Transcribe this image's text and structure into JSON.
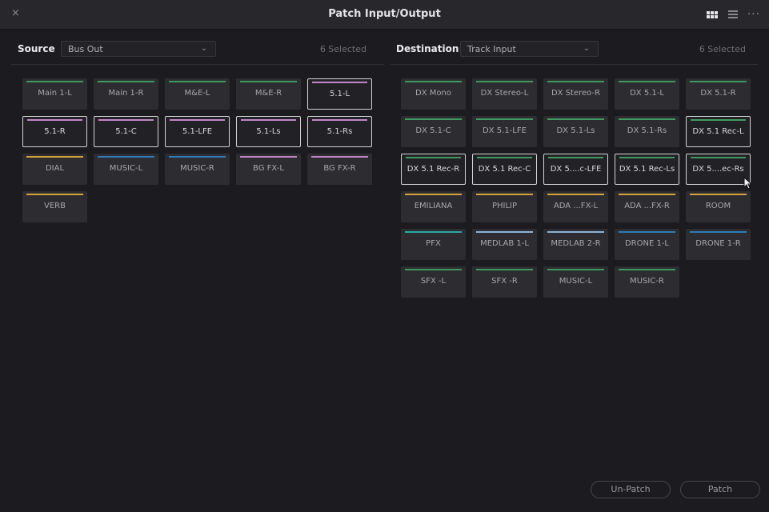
{
  "window": {
    "title": "Patch Input/Output",
    "close_glyph": "×",
    "more_glyph": "···"
  },
  "colors": {
    "green": "#3e9a61",
    "pink": "#c286c9",
    "yellow": "#d6a33b",
    "blue": "#2f7cb8",
    "teal": "#2aa7a3",
    "lightblue": "#8bb3d8",
    "white": "#d8d8da"
  },
  "source": {
    "label": "Source",
    "dropdown_value": "Bus Out",
    "selected_count": "6 Selected",
    "tiles": [
      {
        "label": "Main 1-L",
        "color": "#3e9a61",
        "selected": false
      },
      {
        "label": "Main 1-R",
        "color": "#3e9a61",
        "selected": false
      },
      {
        "label": "M&E-L",
        "color": "#3e9a61",
        "selected": false
      },
      {
        "label": "M&E-R",
        "color": "#3e9a61",
        "selected": false
      },
      {
        "label": "5.1-L",
        "color": "#c286c9",
        "selected": true
      },
      {
        "label": "5.1-R",
        "color": "#c286c9",
        "selected": true
      },
      {
        "label": "5.1-C",
        "color": "#c286c9",
        "selected": true
      },
      {
        "label": "5.1-LFE",
        "color": "#c286c9",
        "selected": true
      },
      {
        "label": "5.1-Ls",
        "color": "#c286c9",
        "selected": true
      },
      {
        "label": "5.1-Rs",
        "color": "#c286c9",
        "selected": true
      },
      {
        "label": "DIAL",
        "color": "#d6a33b",
        "selected": false
      },
      {
        "label": "MUSIC-L",
        "color": "#2f7cb8",
        "selected": false
      },
      {
        "label": "MUSIC-R",
        "color": "#2f7cb8",
        "selected": false
      },
      {
        "label": "BG FX-L",
        "color": "#c286c9",
        "selected": false
      },
      {
        "label": "BG FX-R",
        "color": "#c286c9",
        "selected": false
      },
      {
        "label": "VERB",
        "color": "#d6a33b",
        "selected": false
      }
    ]
  },
  "destination": {
    "label": "Destination",
    "dropdown_value": "Track Input",
    "selected_count": "6 Selected",
    "tiles": [
      {
        "label": "DX Mono",
        "color": "#3e9a61",
        "selected": false
      },
      {
        "label": "DX Stereo-L",
        "color": "#3e9a61",
        "selected": false
      },
      {
        "label": "DX Stereo-R",
        "color": "#3e9a61",
        "selected": false
      },
      {
        "label": "DX 5.1-L",
        "color": "#3e9a61",
        "selected": false
      },
      {
        "label": "DX 5.1-R",
        "color": "#3e9a61",
        "selected": false
      },
      {
        "label": "DX 5.1-C",
        "color": "#3e9a61",
        "selected": false
      },
      {
        "label": "DX 5.1-LFE",
        "color": "#3e9a61",
        "selected": false
      },
      {
        "label": "DX 5.1-Ls",
        "color": "#3e9a61",
        "selected": false
      },
      {
        "label": "DX 5.1-Rs",
        "color": "#3e9a61",
        "selected": false
      },
      {
        "label": "DX 5.1 Rec-L",
        "color": "#3e9a61",
        "selected": true
      },
      {
        "label": "DX 5.1 Rec-R",
        "color": "#3e9a61",
        "selected": true
      },
      {
        "label": "DX 5.1 Rec-C",
        "color": "#3e9a61",
        "selected": true
      },
      {
        "label": "DX 5....c-LFE",
        "color": "#3e9a61",
        "selected": true
      },
      {
        "label": "DX 5.1 Rec-Ls",
        "color": "#3e9a61",
        "selected": true
      },
      {
        "label": "DX 5....ec-Rs",
        "color": "#3e9a61",
        "selected": true
      },
      {
        "label": "EMILIANA",
        "color": "#d6a33b",
        "selected": false
      },
      {
        "label": "PHILIP",
        "color": "#d6a33b",
        "selected": false
      },
      {
        "label": "ADA ...FX-L",
        "color": "#d6a33b",
        "selected": false
      },
      {
        "label": "ADA ...FX-R",
        "color": "#d6a33b",
        "selected": false
      },
      {
        "label": "ROOM",
        "color": "#d6a33b",
        "selected": false
      },
      {
        "label": "PFX",
        "color": "#2aa7a3",
        "selected": false
      },
      {
        "label": "MEDLAB 1-L",
        "color": "#8bb3d8",
        "selected": false
      },
      {
        "label": "MEDLAB 2-R",
        "color": "#8bb3d8",
        "selected": false
      },
      {
        "label": "DRONE 1-L",
        "color": "#2f7cb8",
        "selected": false
      },
      {
        "label": "DRONE 1-R",
        "color": "#2f7cb8",
        "selected": false
      },
      {
        "label": "SFX -L",
        "color": "#3e9a61",
        "selected": false
      },
      {
        "label": "SFX -R",
        "color": "#3e9a61",
        "selected": false
      },
      {
        "label": "MUSIC-L",
        "color": "#3e9a61",
        "selected": false
      },
      {
        "label": "MUSIC-R",
        "color": "#3e9a61",
        "selected": false
      }
    ]
  },
  "footer": {
    "unpatch_label": "Un-Patch",
    "patch_label": "Patch"
  }
}
